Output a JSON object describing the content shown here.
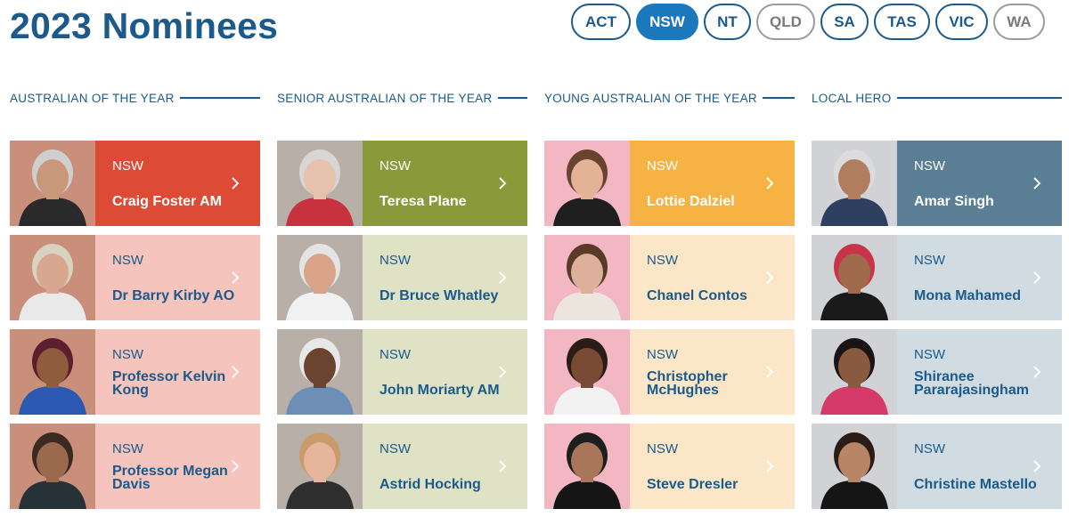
{
  "page": {
    "title": "2023 Nominees"
  },
  "states": [
    {
      "label": "ACT",
      "style": "outline"
    },
    {
      "label": "NSW",
      "style": "active"
    },
    {
      "label": "NT",
      "style": "outline"
    },
    {
      "label": "QLD",
      "style": "muted"
    },
    {
      "label": "SA",
      "style": "outline"
    },
    {
      "label": "TAS",
      "style": "outline"
    },
    {
      "label": "VIC",
      "style": "outline"
    },
    {
      "label": "WA",
      "style": "muted"
    }
  ],
  "columns": [
    {
      "heading": "AUSTRALIAN OF THE YEAR",
      "featured_color": "#dd4b37",
      "light_color": "#f4c4bd",
      "photo_bg": "#c98f7b",
      "nominees": [
        {
          "state": "NSW",
          "name": "Craig Foster AM",
          "skin": "#c99779",
          "hair": "#cfcfcf",
          "top": "#2a2a2a"
        },
        {
          "state": "NSW",
          "name": "Dr Barry Kirby AO",
          "skin": "#d7a88f",
          "hair": "#d8d2c0",
          "top": "#e9e9e9"
        },
        {
          "state": "NSW",
          "name": "Professor Kelvin Kong",
          "skin": "#8f5c3e",
          "hair": "#5c1f2e",
          "top": "#2b58b3"
        },
        {
          "state": "NSW",
          "name": "Professor Megan Davis",
          "skin": "#9b6a4e",
          "hair": "#3a2a22",
          "top": "#263238"
        }
      ]
    },
    {
      "heading": "SENIOR AUSTRALIAN OF THE YEAR",
      "featured_color": "#8a9a3b",
      "light_color": "#dfe2c5",
      "photo_bg": "#b8b0a8",
      "nominees": [
        {
          "state": "NSW",
          "name": "Teresa Plane",
          "skin": "#e6c1ad",
          "hair": "#d8d6d2",
          "top": "#c7323e"
        },
        {
          "state": "NSW",
          "name": "Dr Bruce Whatley",
          "skin": "#d9a38a",
          "hair": "#e4e4e4",
          "top": "#f1f1f1"
        },
        {
          "state": "NSW",
          "name": "John Moriarty AM",
          "skin": "#6b4331",
          "hair": "#e8e8e8",
          "top": "#6d8fb5"
        },
        {
          "state": "NSW",
          "name": "Astrid Hocking",
          "skin": "#e6b59b",
          "hair": "#c99a6a",
          "top": "#2f2f2f"
        }
      ]
    },
    {
      "heading": "YOUNG AUSTRALIAN OF THE YEAR",
      "featured_color": "#f7b244",
      "light_color": "#fbe6c8",
      "photo_bg": "#f2b7c2",
      "nominees": [
        {
          "state": "NSW",
          "name": "Lottie Dalziel",
          "skin": "#e4b296",
          "hair": "#6a4330",
          "top": "#1f1f1f"
        },
        {
          "state": "NSW",
          "name": "Chanel Contos",
          "skin": "#dcb09a",
          "hair": "#5a3a28",
          "top": "#ece6de"
        },
        {
          "state": "NSW",
          "name": "Christopher McHughes",
          "skin": "#7a4b34",
          "hair": "#2a1d18",
          "top": "#f2f2f2"
        },
        {
          "state": "NSW",
          "name": "Steve Dresler",
          "skin": "#a9765a",
          "hair": "#1e1e1e",
          "top": "#151515"
        }
      ]
    },
    {
      "heading": "LOCAL HERO",
      "featured_color": "#5a7f94",
      "light_color": "#d1dce2",
      "photo_bg": "#d0d2d6",
      "nominees": [
        {
          "state": "NSW",
          "name": "Amar Singh",
          "skin": "#b07d5e",
          "hair": "#dcdcdc",
          "top": "#2f3f60"
        },
        {
          "state": "NSW",
          "name": "Mona Mahamed",
          "skin": "#a06a4c",
          "hair": "#c8344a",
          "top": "#1a1a1a"
        },
        {
          "state": "NSW",
          "name": "Shiranee Pararajasingham",
          "skin": "#8a5a40",
          "hair": "#1a1414",
          "top": "#d63a6a"
        },
        {
          "state": "NSW",
          "name": "Christine Mastello",
          "skin": "#b88566",
          "hair": "#2a1c16",
          "top": "#151515"
        }
      ]
    }
  ]
}
